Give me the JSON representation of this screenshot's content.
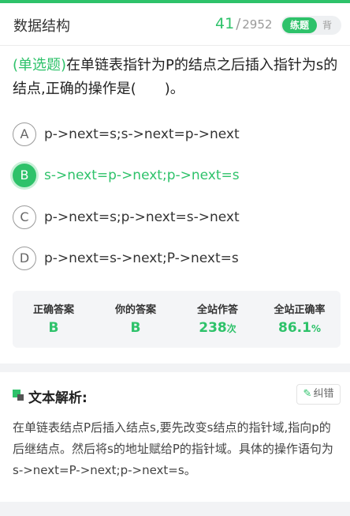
{
  "header": {
    "subject": "数据结构",
    "current": "41",
    "separator": "/",
    "total": "2952",
    "mode_practice": "练题",
    "mode_recite": "背"
  },
  "question": {
    "type": "(单选题)",
    "text": "在单链表指针为P的结点之后插入指针为s的结点,正确的操作是(　　)。"
  },
  "options": [
    {
      "letter": "A",
      "text": "p->next=s;s->next=p->next",
      "selected": false
    },
    {
      "letter": "B",
      "text": "s->next=p->next;p->next=s",
      "selected": true
    },
    {
      "letter": "C",
      "text": "p->next=s;p->next=s->next",
      "selected": false
    },
    {
      "letter": "D",
      "text": "p->next=s->next;P->next=s",
      "selected": false
    }
  ],
  "stats": {
    "correct_label": "正确答案",
    "correct_value": "B",
    "yours_label": "你的答案",
    "yours_value": "B",
    "count_label": "全站作答",
    "count_value": "238",
    "count_unit": "次",
    "rate_label": "全站正确率",
    "rate_value": "86.1",
    "rate_unit": "%"
  },
  "analysis": {
    "title": "文本解析:",
    "report_label": "纠错",
    "text": "在单链表结点P后插入结点s,要先改变s结点的指针域,指向p的后继结点。然后将s的地址赋给P的指针域。具体的操作语句为s->next=P->next;p->next=s。"
  },
  "colors": {
    "accent": "#2ec26a",
    "background": "#f2f3f5"
  }
}
